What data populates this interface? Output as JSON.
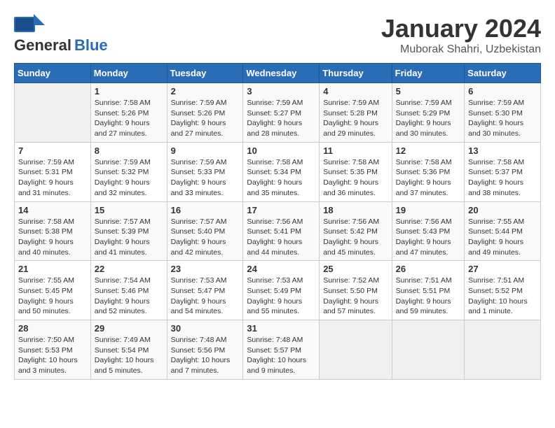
{
  "logo": {
    "general": "General",
    "blue": "Blue"
  },
  "title": {
    "month": "January 2024",
    "location": "Muborak Shahri, Uzbekistan"
  },
  "weekdays": [
    "Sunday",
    "Monday",
    "Tuesday",
    "Wednesday",
    "Thursday",
    "Friday",
    "Saturday"
  ],
  "weeks": [
    [
      {
        "day": "",
        "info": ""
      },
      {
        "day": "1",
        "info": "Sunrise: 7:58 AM\nSunset: 5:26 PM\nDaylight: 9 hours\nand 27 minutes."
      },
      {
        "day": "2",
        "info": "Sunrise: 7:59 AM\nSunset: 5:26 PM\nDaylight: 9 hours\nand 27 minutes."
      },
      {
        "day": "3",
        "info": "Sunrise: 7:59 AM\nSunset: 5:27 PM\nDaylight: 9 hours\nand 28 minutes."
      },
      {
        "day": "4",
        "info": "Sunrise: 7:59 AM\nSunset: 5:28 PM\nDaylight: 9 hours\nand 29 minutes."
      },
      {
        "day": "5",
        "info": "Sunrise: 7:59 AM\nSunset: 5:29 PM\nDaylight: 9 hours\nand 30 minutes."
      },
      {
        "day": "6",
        "info": "Sunrise: 7:59 AM\nSunset: 5:30 PM\nDaylight: 9 hours\nand 30 minutes."
      }
    ],
    [
      {
        "day": "7",
        "info": "Sunrise: 7:59 AM\nSunset: 5:31 PM\nDaylight: 9 hours\nand 31 minutes."
      },
      {
        "day": "8",
        "info": "Sunrise: 7:59 AM\nSunset: 5:32 PM\nDaylight: 9 hours\nand 32 minutes."
      },
      {
        "day": "9",
        "info": "Sunrise: 7:59 AM\nSunset: 5:33 PM\nDaylight: 9 hours\nand 33 minutes."
      },
      {
        "day": "10",
        "info": "Sunrise: 7:58 AM\nSunset: 5:34 PM\nDaylight: 9 hours\nand 35 minutes."
      },
      {
        "day": "11",
        "info": "Sunrise: 7:58 AM\nSunset: 5:35 PM\nDaylight: 9 hours\nand 36 minutes."
      },
      {
        "day": "12",
        "info": "Sunrise: 7:58 AM\nSunset: 5:36 PM\nDaylight: 9 hours\nand 37 minutes."
      },
      {
        "day": "13",
        "info": "Sunrise: 7:58 AM\nSunset: 5:37 PM\nDaylight: 9 hours\nand 38 minutes."
      }
    ],
    [
      {
        "day": "14",
        "info": "Sunrise: 7:58 AM\nSunset: 5:38 PM\nDaylight: 9 hours\nand 40 minutes."
      },
      {
        "day": "15",
        "info": "Sunrise: 7:57 AM\nSunset: 5:39 PM\nDaylight: 9 hours\nand 41 minutes."
      },
      {
        "day": "16",
        "info": "Sunrise: 7:57 AM\nSunset: 5:40 PM\nDaylight: 9 hours\nand 42 minutes."
      },
      {
        "day": "17",
        "info": "Sunrise: 7:56 AM\nSunset: 5:41 PM\nDaylight: 9 hours\nand 44 minutes."
      },
      {
        "day": "18",
        "info": "Sunrise: 7:56 AM\nSunset: 5:42 PM\nDaylight: 9 hours\nand 45 minutes."
      },
      {
        "day": "19",
        "info": "Sunrise: 7:56 AM\nSunset: 5:43 PM\nDaylight: 9 hours\nand 47 minutes."
      },
      {
        "day": "20",
        "info": "Sunrise: 7:55 AM\nSunset: 5:44 PM\nDaylight: 9 hours\nand 49 minutes."
      }
    ],
    [
      {
        "day": "21",
        "info": "Sunrise: 7:55 AM\nSunset: 5:45 PM\nDaylight: 9 hours\nand 50 minutes."
      },
      {
        "day": "22",
        "info": "Sunrise: 7:54 AM\nSunset: 5:46 PM\nDaylight: 9 hours\nand 52 minutes."
      },
      {
        "day": "23",
        "info": "Sunrise: 7:53 AM\nSunset: 5:47 PM\nDaylight: 9 hours\nand 54 minutes."
      },
      {
        "day": "24",
        "info": "Sunrise: 7:53 AM\nSunset: 5:49 PM\nDaylight: 9 hours\nand 55 minutes."
      },
      {
        "day": "25",
        "info": "Sunrise: 7:52 AM\nSunset: 5:50 PM\nDaylight: 9 hours\nand 57 minutes."
      },
      {
        "day": "26",
        "info": "Sunrise: 7:51 AM\nSunset: 5:51 PM\nDaylight: 9 hours\nand 59 minutes."
      },
      {
        "day": "27",
        "info": "Sunrise: 7:51 AM\nSunset: 5:52 PM\nDaylight: 10 hours\nand 1 minute."
      }
    ],
    [
      {
        "day": "28",
        "info": "Sunrise: 7:50 AM\nSunset: 5:53 PM\nDaylight: 10 hours\nand 3 minutes."
      },
      {
        "day": "29",
        "info": "Sunrise: 7:49 AM\nSunset: 5:54 PM\nDaylight: 10 hours\nand 5 minutes."
      },
      {
        "day": "30",
        "info": "Sunrise: 7:48 AM\nSunset: 5:56 PM\nDaylight: 10 hours\nand 7 minutes."
      },
      {
        "day": "31",
        "info": "Sunrise: 7:48 AM\nSunset: 5:57 PM\nDaylight: 10 hours\nand 9 minutes."
      },
      {
        "day": "",
        "info": ""
      },
      {
        "day": "",
        "info": ""
      },
      {
        "day": "",
        "info": ""
      }
    ]
  ]
}
